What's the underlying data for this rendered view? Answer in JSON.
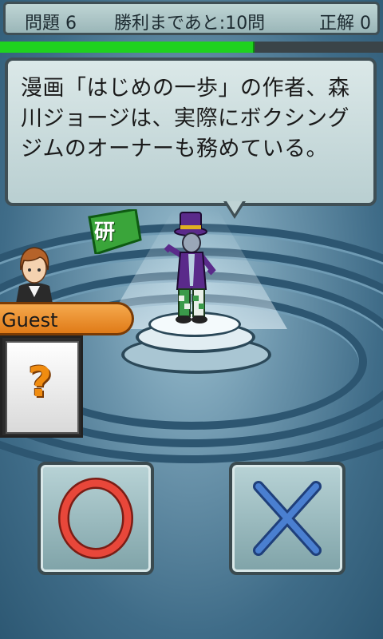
{
  "header": {
    "question_number": "問題 6",
    "remaining_to_win": "勝利まであと:10問",
    "correct_count": "正解 0",
    "time_remaining_fraction": 0.66
  },
  "question": {
    "text": "漫画「はじめの一歩」の作者、森川ジョージは、実際にボクシングジムのオーナーも務めている。"
  },
  "genre_badge": "研",
  "player": {
    "name": "Guest",
    "card_symbol": "?"
  },
  "colors": {
    "progress": "#1fd21f",
    "answer_true": "#e8473a",
    "answer_false": "#4a7fd0",
    "name_bar": "#f09a30"
  },
  "icons": {
    "true_button": "circle-icon",
    "false_button": "cross-icon"
  }
}
